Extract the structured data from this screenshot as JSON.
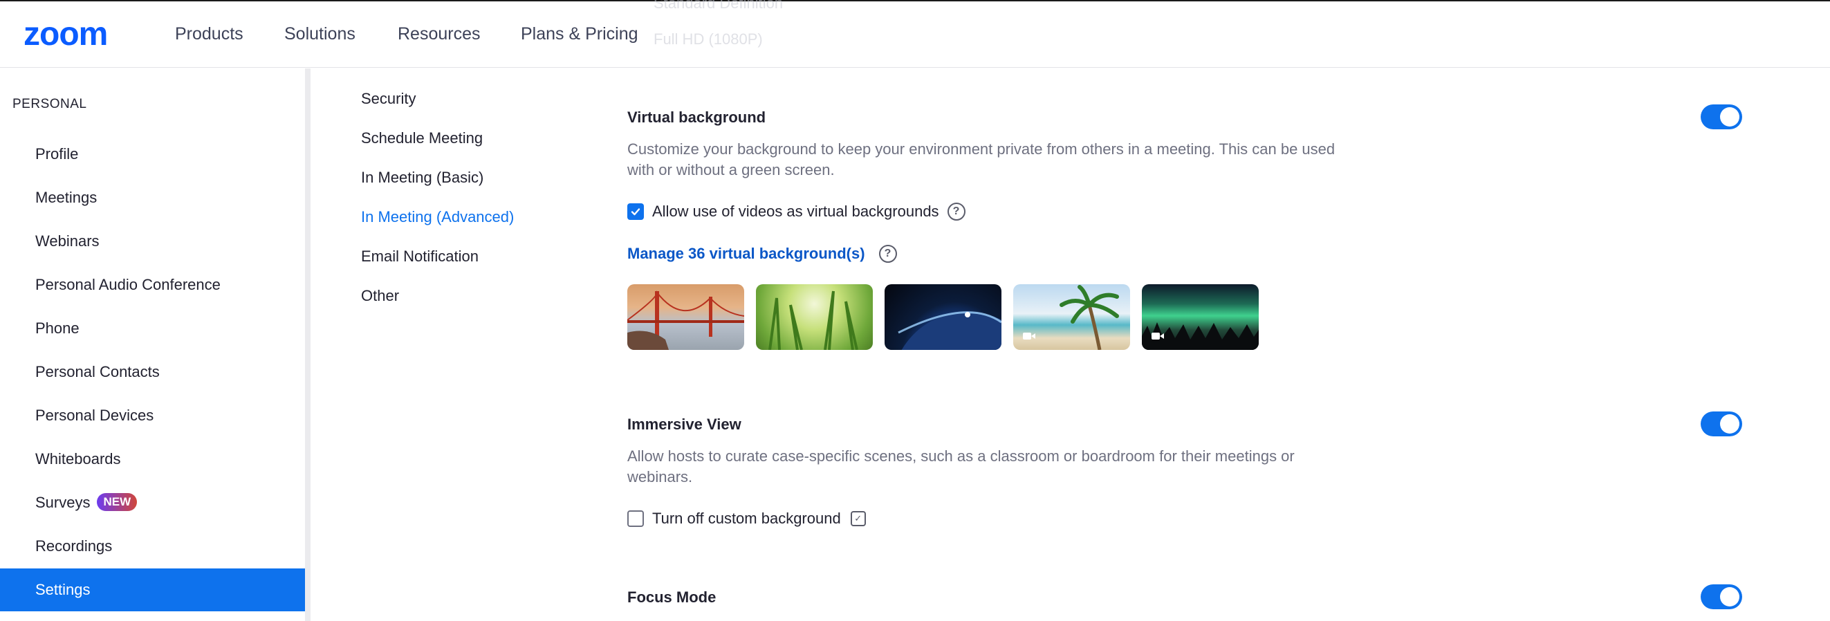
{
  "header": {
    "logo": "zoom",
    "nav": [
      "Products",
      "Solutions",
      "Resources",
      "Plans & Pricing"
    ],
    "ghost_text": [
      "Standard Definition",
      "Full HD (1080P)"
    ],
    "brand_color": "#0b5cff"
  },
  "sidebar": {
    "section_label": "PERSONAL",
    "items": [
      {
        "label": "Profile"
      },
      {
        "label": "Meetings"
      },
      {
        "label": "Webinars"
      },
      {
        "label": "Personal Audio Conference"
      },
      {
        "label": "Phone"
      },
      {
        "label": "Personal Contacts"
      },
      {
        "label": "Personal Devices"
      },
      {
        "label": "Whiteboards"
      },
      {
        "label": "Surveys",
        "badge": "NEW"
      },
      {
        "label": "Recordings"
      },
      {
        "label": "Settings",
        "active": true
      }
    ],
    "active_color": "#0e72ed"
  },
  "subnav": {
    "items": [
      {
        "label": "Security"
      },
      {
        "label": "Schedule Meeting"
      },
      {
        "label": "In Meeting (Basic)"
      },
      {
        "label": "In Meeting (Advanced)",
        "active": true
      },
      {
        "label": "Email Notification"
      },
      {
        "label": "Other"
      }
    ]
  },
  "settings": {
    "virtual_background": {
      "title": "Virtual background",
      "description": "Customize your background to keep your environment private from others in a meeting. This can be used with or without a green screen.",
      "enabled": true,
      "allow_videos_label": "Allow use of videos as virtual backgrounds",
      "allow_videos_checked": true,
      "manage_link": "Manage 36 virtual background(s)",
      "thumbnails": [
        {
          "name": "golden-gate-bridge",
          "video": false
        },
        {
          "name": "grass",
          "video": false
        },
        {
          "name": "earth-from-space",
          "video": false
        },
        {
          "name": "beach-palm",
          "video": true
        },
        {
          "name": "aurora",
          "video": true
        }
      ]
    },
    "immersive_view": {
      "title": "Immersive View",
      "description": "Allow hosts to curate case-specific scenes, such as a classroom or boardroom for their meetings or webinars.",
      "enabled": true,
      "turn_off_label": "Turn off custom background",
      "turn_off_checked": false
    },
    "focus_mode": {
      "title": "Focus Mode",
      "enabled": true
    }
  },
  "icons": {
    "help": "help-circle-icon",
    "verify": "checkmark-square-icon",
    "video": "video-camera-icon",
    "checkbox": "checkmark-icon"
  }
}
